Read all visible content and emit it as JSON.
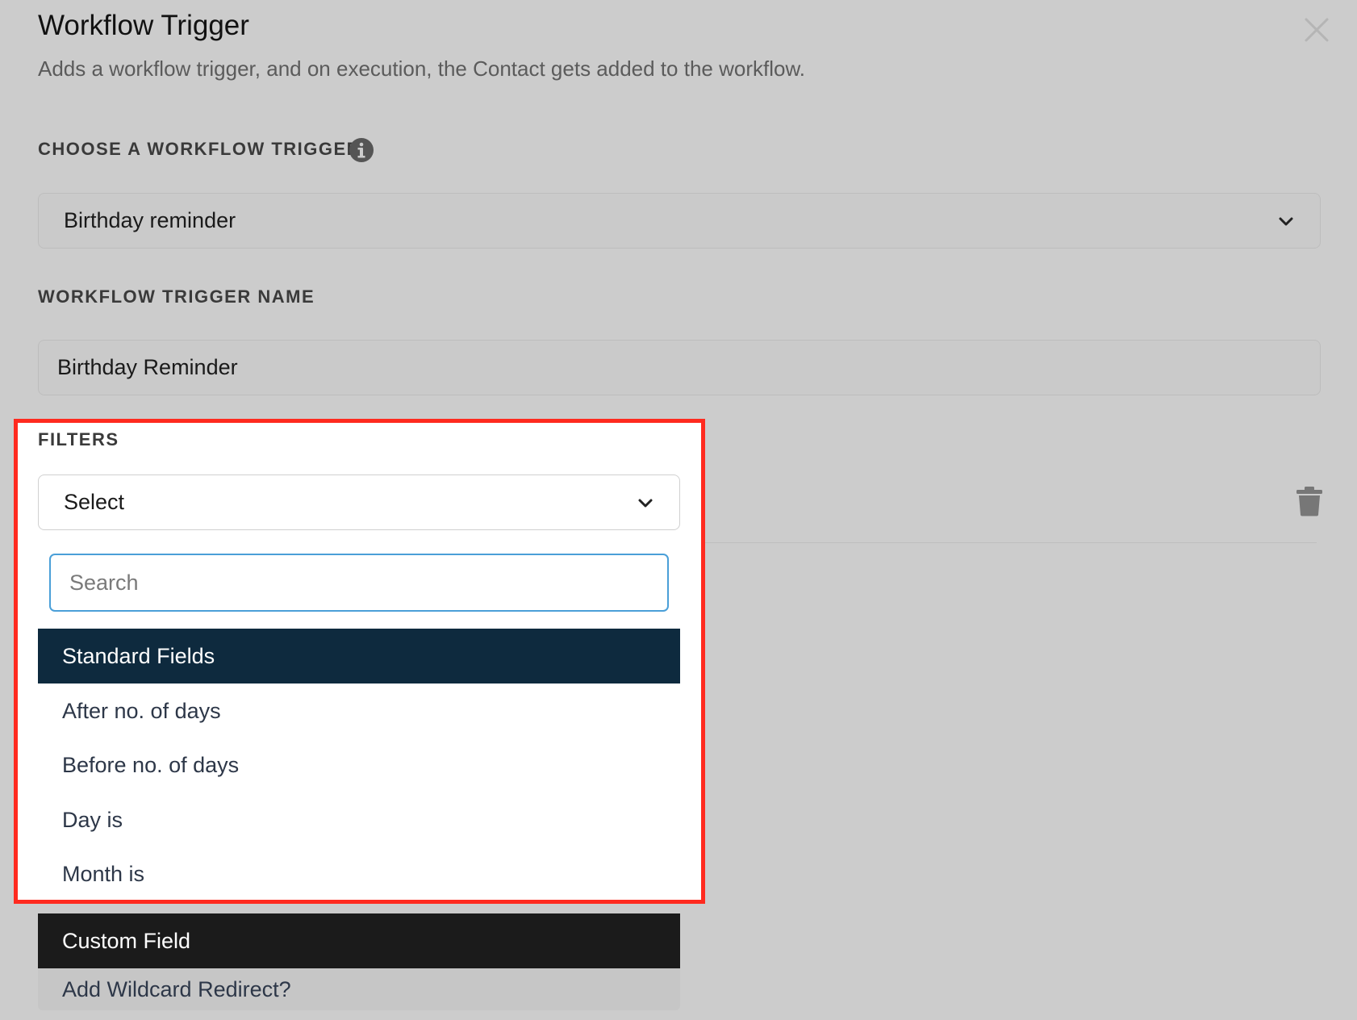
{
  "header": {
    "title": "Workflow Trigger",
    "subtitle": "Adds a workflow trigger, and on execution, the Contact gets added to the workflow."
  },
  "trigger": {
    "label": "CHOOSE A WORKFLOW TRIGGER",
    "selected": "Birthday reminder"
  },
  "trigger_name": {
    "label": "WORKFLOW TRIGGER NAME",
    "value": "Birthday Reminder"
  },
  "filters": {
    "label": "FILTERS",
    "select_value": "Select",
    "search_placeholder": "Search",
    "groups": [
      {
        "name": "Standard Fields",
        "options": [
          "After no. of days",
          "Before no. of days",
          "Day is",
          "Month is"
        ]
      },
      {
        "name": "Custom Field",
        "options": [
          "Add Wildcard Redirect?"
        ]
      }
    ]
  },
  "colors": {
    "highlight_border": "#ff2a1f",
    "standard_group_bg": "#0e2a3e",
    "custom_group_bg": "#1b1b1b",
    "search_focus": "#4a9fd8"
  },
  "icons": [
    "close-icon",
    "info-icon",
    "chevron-down-icon",
    "trash-icon"
  ]
}
